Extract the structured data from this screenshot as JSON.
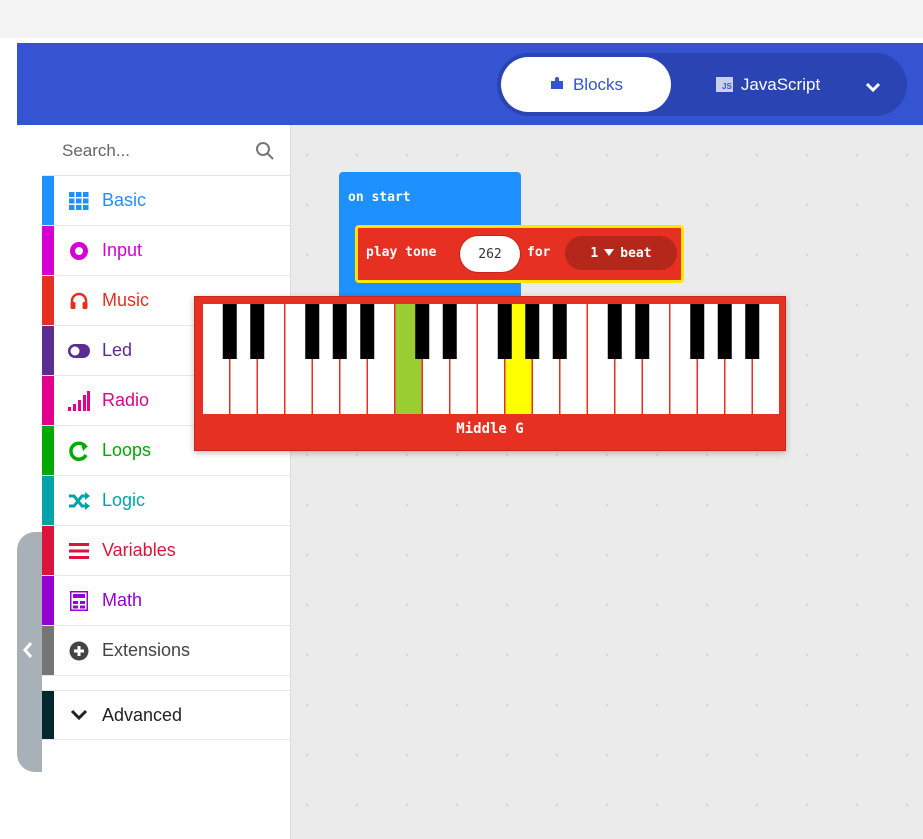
{
  "header": {
    "tabs": [
      {
        "label": "Blocks",
        "icon": "puzzle-icon",
        "active": true
      },
      {
        "label": "JavaScript",
        "icon": "js-icon",
        "active": false
      }
    ],
    "js_badge": "JS",
    "accent": "#3454d1"
  },
  "toolbox": {
    "search_placeholder": "Search...",
    "categories": [
      {
        "label": "Basic",
        "color": "#1e90ff",
        "icon": "grid-icon"
      },
      {
        "label": "Input",
        "color": "#d400d4",
        "icon": "circle-dot-icon"
      },
      {
        "label": "Music",
        "color": "#e63022",
        "icon": "headphones-icon"
      },
      {
        "label": "Led",
        "color": "#5c2d91",
        "icon": "toggle-icon"
      },
      {
        "label": "Radio",
        "color": "#e3008c",
        "icon": "signal-bars-icon"
      },
      {
        "label": "Loops",
        "color": "#00aa00",
        "icon": "loop-arrow-icon"
      },
      {
        "label": "Logic",
        "color": "#00a4a6",
        "icon": "shuffle-icon"
      },
      {
        "label": "Variables",
        "color": "#dc143c",
        "icon": "list-lines-icon"
      },
      {
        "label": "Math",
        "color": "#9400d3",
        "icon": "calculator-icon"
      },
      {
        "label": "Extensions",
        "color": "#757575",
        "icon": "plus-circle-icon"
      }
    ],
    "advanced": {
      "label": "Advanced",
      "color": "#00272b",
      "icon": "chevron-down-icon"
    }
  },
  "workspace": {
    "on_start": "on start",
    "play_tone": "play tone",
    "tone_value": "262",
    "for_label": "for",
    "beat_value": "1",
    "beat_label": "beat",
    "piano": {
      "note_label": "Middle G",
      "selected_key_color": "#ffff00",
      "hover_key_color": "#9acd32"
    }
  }
}
